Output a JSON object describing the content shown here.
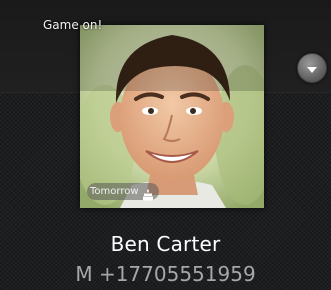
{
  "header": {
    "status_text": "Game on!"
  },
  "contact": {
    "name": "Ben Carter",
    "phone_type": "M",
    "phone_number": "+17705551959"
  },
  "event": {
    "label": "Tomorrow",
    "icon": "birthday-cake-icon"
  },
  "controls": {
    "expand_icon": "chevron-down-icon"
  },
  "colors": {
    "background": "#1c1d1f",
    "name_text": "#ffffff",
    "phone_text": "#a7a7a7"
  }
}
